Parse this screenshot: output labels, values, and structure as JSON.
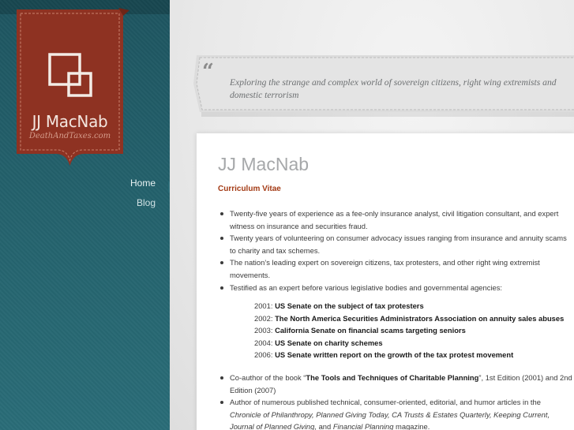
{
  "site": {
    "brand_name": "JJ MacNab",
    "brand_sub": "DeathAndTaxes.com",
    "tagline": "Exploring the strange and complex world of sovereign citizens, right wing extremists and domestic terrorism",
    "quote_open": "“",
    "quote_close": "›"
  },
  "nav": {
    "items": [
      {
        "label": "Home",
        "active": true
      },
      {
        "label": "Blog",
        "active": false
      }
    ]
  },
  "page": {
    "title": "JJ MacNab",
    "section_heading": "Curriculum Vitae",
    "bullets": [
      "Twenty-five years of experience as a fee-only insurance analyst, civil litigation consultant, and expert witness on insurance and securities fraud.",
      "Twenty years of volunteering on consumer advocacy issues ranging from insurance and annuity scams to charity and tax schemes.",
      "The nation’s leading expert on sovereign citizens, tax protesters, and other right wing extremist movements.",
      "Testified as an expert before various legislative bodies and governmental agencies:"
    ],
    "testimony": [
      {
        "year": "2001:",
        "body": "US Senate on the subject of tax protesters"
      },
      {
        "year": "2002:",
        "body": "The North America Securities Administrators Association on annuity sales abuses"
      },
      {
        "year": "2003:",
        "body": "California Senate on financial scams targeting seniors"
      },
      {
        "year": "2004:",
        "body": "US Senate on charity schemes"
      },
      {
        "year": "2006:",
        "body": "US Senate written report on the growth of the tax protest movement"
      }
    ],
    "coauthor": {
      "prefix": "Co-author of the book “",
      "book": "The Tools and Techniques of Charitable Planning",
      "suffix": "”, 1st Edition (2001) and 2nd Edition (2007)"
    },
    "author": {
      "prefix": "Author of numerous published technical, consumer-oriented, editorial, and humor articles in the ",
      "pubs1": "Chronicle of Philanthropy, Planned Giving Today, CA Trusts & Estates Quarterly, Keeping Current,",
      "pubs2": "Journal of Planned Giving,",
      "mid": " and ",
      "pubs3": "Financial Planning",
      "suffix": " magazine."
    }
  },
  "colors": {
    "sidebar": "#23606b",
    "brand_red": "#8e3222",
    "heading_accent": "#a33a14"
  }
}
